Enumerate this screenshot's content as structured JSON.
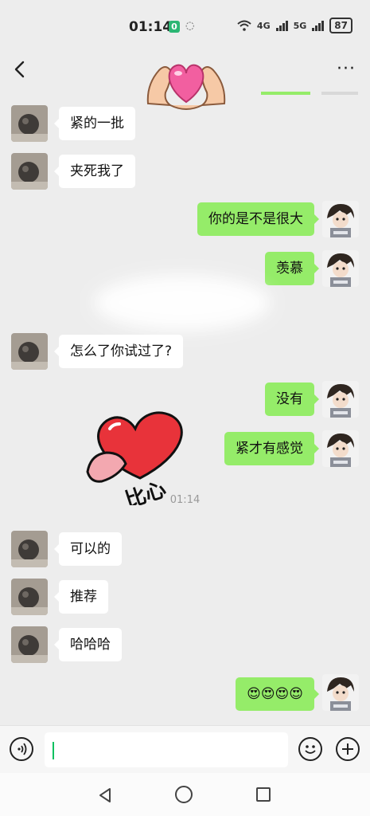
{
  "status": {
    "time": "01:14",
    "badge": "0",
    "net1": "4G",
    "net2": "5G",
    "battery": "87"
  },
  "header": {
    "more_label": "···"
  },
  "messages": [
    {
      "side": "in",
      "text": "紧的一批"
    },
    {
      "side": "in",
      "text": "夹死我了"
    },
    {
      "side": "out",
      "text": "你的是不是很大"
    },
    {
      "side": "out",
      "text": "羡慕"
    },
    {
      "side": "in",
      "text": "怎么了你试过了?"
    },
    {
      "side": "out",
      "text": "没有"
    },
    {
      "side": "out",
      "text": "紧才有感觉"
    },
    {
      "side": "in",
      "text": "可以的"
    },
    {
      "side": "in",
      "text": "推荐"
    },
    {
      "side": "in",
      "text": "哈哈哈"
    },
    {
      "side": "out",
      "text": "😍😍😍😍"
    }
  ],
  "stickers": {
    "heart_text": "比心"
  },
  "timestamp": "01:14",
  "input": {
    "value": ""
  },
  "colors": {
    "background": "#ededed",
    "outgoing_bubble": "#95ec69",
    "incoming_bubble": "#ffffff",
    "accent": "#07c160"
  }
}
